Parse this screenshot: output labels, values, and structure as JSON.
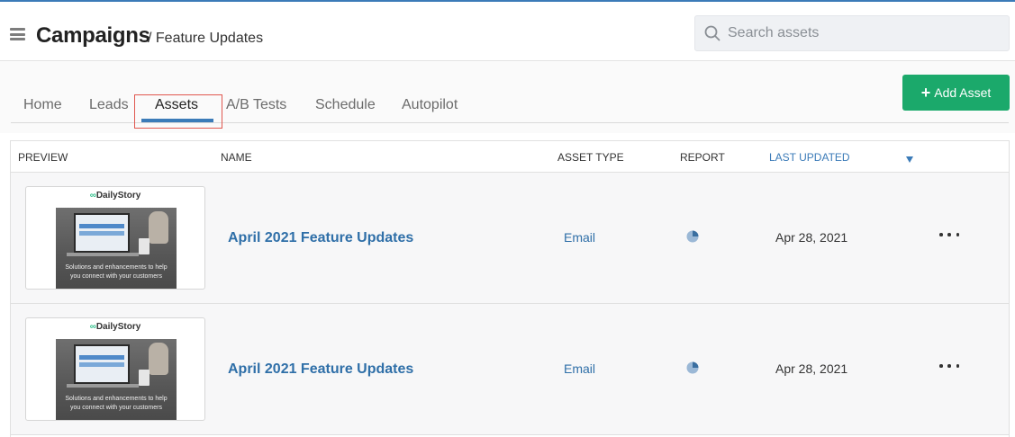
{
  "header": {
    "title": "Campaigns",
    "breadcrumb": "/ Feature Updates",
    "search": {
      "placeholder": "Search assets"
    }
  },
  "tabs": [
    {
      "label": "Home"
    },
    {
      "label": "Leads"
    },
    {
      "label": "Assets",
      "active": true
    },
    {
      "label": "A/B Tests"
    },
    {
      "label": "Schedule"
    },
    {
      "label": "Autopilot"
    }
  ],
  "toolbar": {
    "add_label": "Add Asset"
  },
  "table": {
    "columns": {
      "preview": "PREVIEW",
      "name": "NAME",
      "asset_type": "ASSET TYPE",
      "report": "REPORT",
      "last_updated": "LAST UPDATED"
    },
    "rows": [
      {
        "name": "April 2021 Feature Updates",
        "type": "Email",
        "updated": "Apr 28, 2021",
        "thumb": {
          "logo": "DailyStory",
          "line1": "Solutions and enhancements to help",
          "line2": "you connect with your customers"
        }
      },
      {
        "name": "April 2021 Feature Updates",
        "type": "Email",
        "updated": "Apr 28, 2021",
        "thumb": {
          "logo": "DailyStory",
          "line1": "Solutions and enhancements to help",
          "line2": "you connect with your customers"
        }
      }
    ]
  },
  "colors": {
    "accent": "#3b7bb8",
    "link": "#2f6fa8",
    "add_button": "#1ba96b",
    "highlight": "#e0574f"
  },
  "icons": {
    "menu": "hamburger-icon",
    "search": "search-icon",
    "report": "pie-chart-icon",
    "more": "more-horizontal-icon",
    "sort": "sort-down-icon",
    "add": "plus-icon"
  }
}
